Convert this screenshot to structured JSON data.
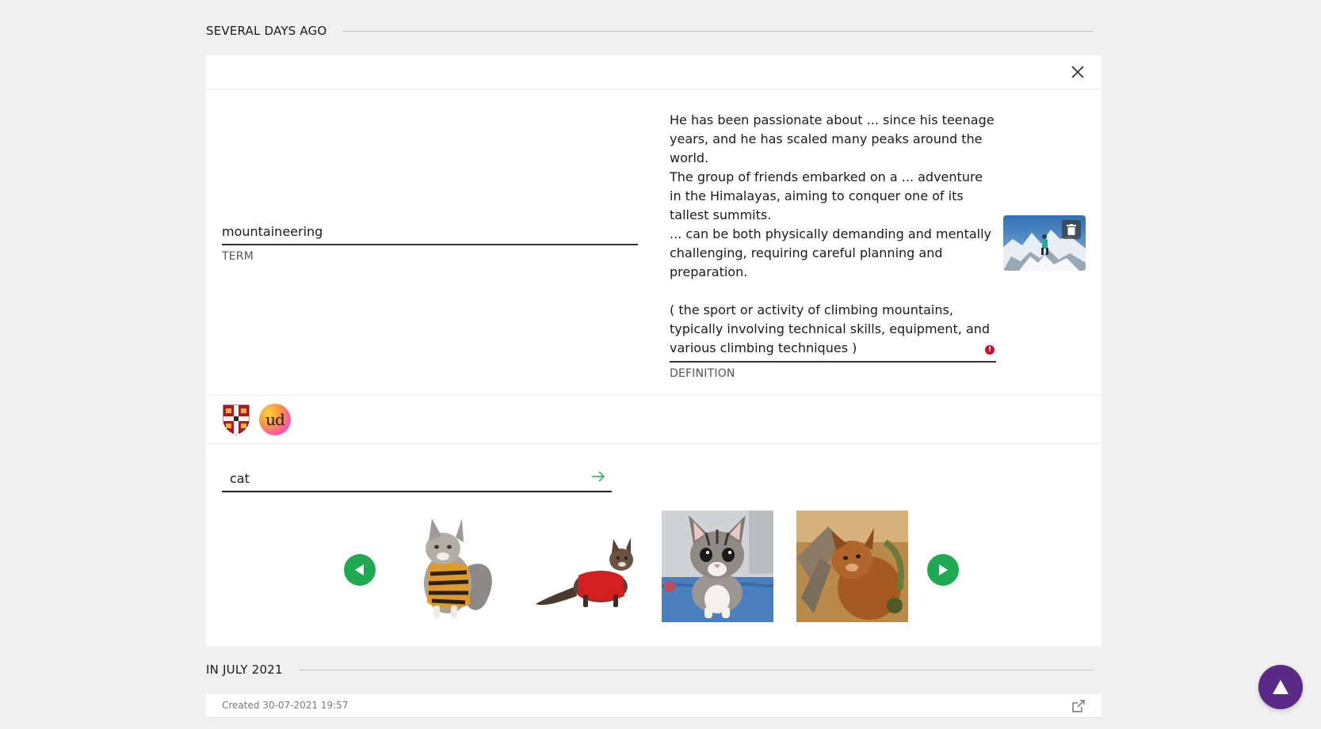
{
  "sections": [
    {
      "heading": "SEVERAL DAYS AGO"
    },
    {
      "heading": "IN JULY 2021"
    }
  ],
  "entry": {
    "term": {
      "value": "mountaineering",
      "caption": "TERM"
    },
    "definition": {
      "examples": [
        "He has been passionate about ... since his teenage years, and he has scaled many peaks around the world.",
        "The group of friends embarked on a ... adventure in the Himalayas, aiming to conquer one of its tallest summits.",
        "... can be both physically demanding and mentally challenging, requiring careful planning and preparation."
      ],
      "meaning": "( the sport or activity of climbing mountains, typically involving technical skills, equipment, and various climbing techniques )",
      "caption": "DEFINITION",
      "error_icon": "!"
    },
    "sources": [
      {
        "icon": "cambridge-crest-icon"
      },
      {
        "icon": "urban-dictionary-icon",
        "text": "ud"
      }
    ],
    "image_search": {
      "query": "cat",
      "results": [
        {
          "subject": "maine-coon-in-tiger-sweater"
        },
        {
          "subject": "cat-in-red-sweater"
        },
        {
          "subject": "tabby-kitten-on-blue-blanket"
        },
        {
          "subject": "wild-cat-on-tree"
        }
      ]
    }
  },
  "entry2": {
    "created": "Created 30-07-2021 19:57"
  },
  "colors": {
    "accent_green": "#1faa52",
    "error_red": "#c8102e",
    "scroll_top_purple": "#5b2a86"
  }
}
